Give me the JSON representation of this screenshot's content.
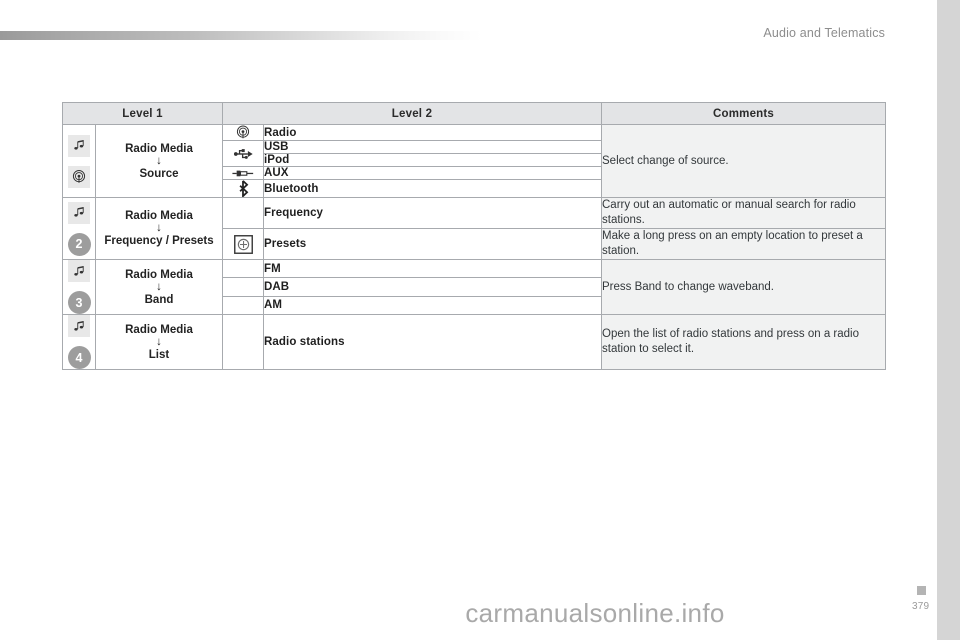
{
  "header": {
    "title": "Audio and Telematics"
  },
  "table": {
    "columns": [
      "Level 1",
      "Level 2",
      "Comments"
    ],
    "rows": [
      {
        "badge": null,
        "first_col_icons": [
          "music-note-icon",
          "radio-antenna-icon"
        ],
        "level1_top": "Radio Media",
        "level1_arrow": "↓",
        "level1_bottom": "Source",
        "comment": "Select change of source.",
        "entries": [
          {
            "icon": "radio-antenna-icon",
            "label": "Radio"
          },
          {
            "icon": "usb-icon",
            "label": "USB"
          },
          {
            "icon": "usb-icon",
            "label": "iPod"
          },
          {
            "icon": "aux-jack-icon",
            "label": "AUX"
          },
          {
            "icon": "bluetooth-icon",
            "label": "Bluetooth"
          }
        ]
      },
      {
        "badge": "2",
        "first_col_icons": [
          "music-note-icon"
        ],
        "level1_top": "Radio Media",
        "level1_arrow": "↓",
        "level1_bottom": "Frequency / Presets",
        "entries": [
          {
            "icon": null,
            "label": "Frequency",
            "comment": "Carry out an automatic or manual search for radio stations."
          },
          {
            "icon": "preset-plus-icon",
            "label": "Presets",
            "comment": "Make a long press on an empty location to preset a station."
          }
        ]
      },
      {
        "badge": "3",
        "first_col_icons": [
          "music-note-icon"
        ],
        "level1_top": "Radio Media",
        "level1_arrow": "↓",
        "level1_bottom": "Band",
        "comment": "Press Band to change waveband.",
        "entries": [
          {
            "icon": null,
            "label": "FM"
          },
          {
            "icon": null,
            "label": "DAB"
          },
          {
            "icon": null,
            "label": "AM"
          }
        ]
      },
      {
        "badge": "4",
        "first_col_icons": [
          "music-note-icon"
        ],
        "level1_top": "Radio Media",
        "level1_arrow": "↓",
        "level1_bottom": "List",
        "comment": "Open the list of radio stations and press on a radio station to select it.",
        "entries": [
          {
            "icon": null,
            "label": "Radio stations"
          }
        ]
      }
    ]
  },
  "footer": {
    "page_number": "379",
    "watermark": "carmanualsonline.info"
  },
  "colors": {
    "header_fill": "#e3e4e6",
    "comment_fill": "#f1f2f2",
    "border": "#a7aaae",
    "badge_fill": "#9d9d9d",
    "title_text": "#8d8d8d"
  }
}
